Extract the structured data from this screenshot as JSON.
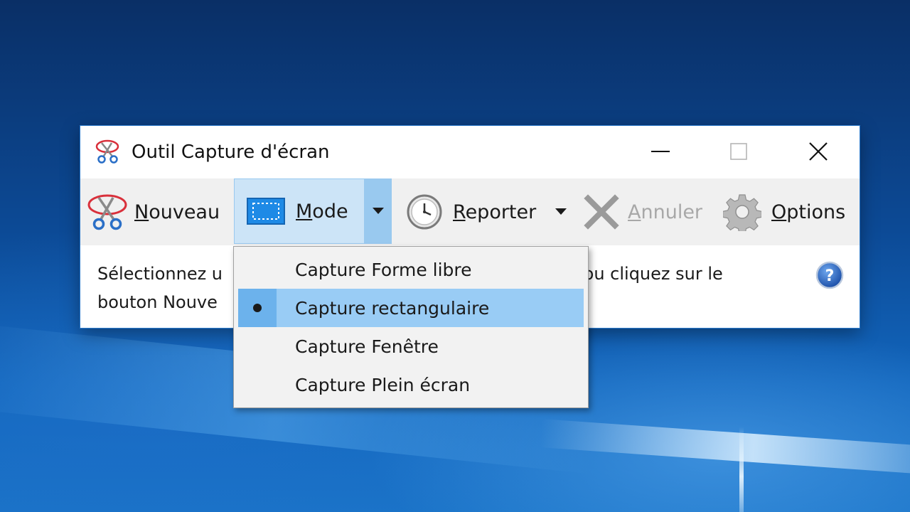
{
  "window": {
    "title": "Outil Capture d'écran",
    "controls": [
      "minimize",
      "maximize",
      "close"
    ]
  },
  "toolbar": {
    "nouveau": {
      "label": "Nouveau",
      "mnemonic": "N",
      "rest": "ouveau",
      "icon": "snipping-scissors-icon"
    },
    "mode": {
      "label": "Mode",
      "mnemonic": "M",
      "rest": "ode",
      "icon": "rectangle-select-icon"
    },
    "reporter": {
      "label": "Reporter",
      "mnemonic": "R",
      "rest": "eporter",
      "icon": "clock-icon"
    },
    "annuler": {
      "label": "Annuler",
      "mnemonic": "A",
      "rest": "nnuler",
      "icon": "x-cancel-icon",
      "disabled": true
    },
    "options": {
      "label": "Options",
      "mnemonic": "O",
      "rest": "ptions",
      "icon": "gear-icon"
    }
  },
  "content": {
    "description_line1_start": "Sélectionnez u",
    "description_line1_end": "de ou cliquez sur le",
    "description_line2": "bouton Nouve",
    "help_icon": "help-icon"
  },
  "mode_menu": {
    "items": [
      {
        "label": "Capture Forme libre",
        "selected": false
      },
      {
        "label": "Capture rectangulaire",
        "selected": true
      },
      {
        "label": "Capture Fenêtre",
        "selected": false
      },
      {
        "label": "Capture Plein écran",
        "selected": false
      }
    ]
  },
  "colors": {
    "mode_button_bg": "#cce4f7",
    "menu_selected_bg": "#99ccf5",
    "window_border": "#2a78c9",
    "disabled_text": "#a8a8a8"
  }
}
